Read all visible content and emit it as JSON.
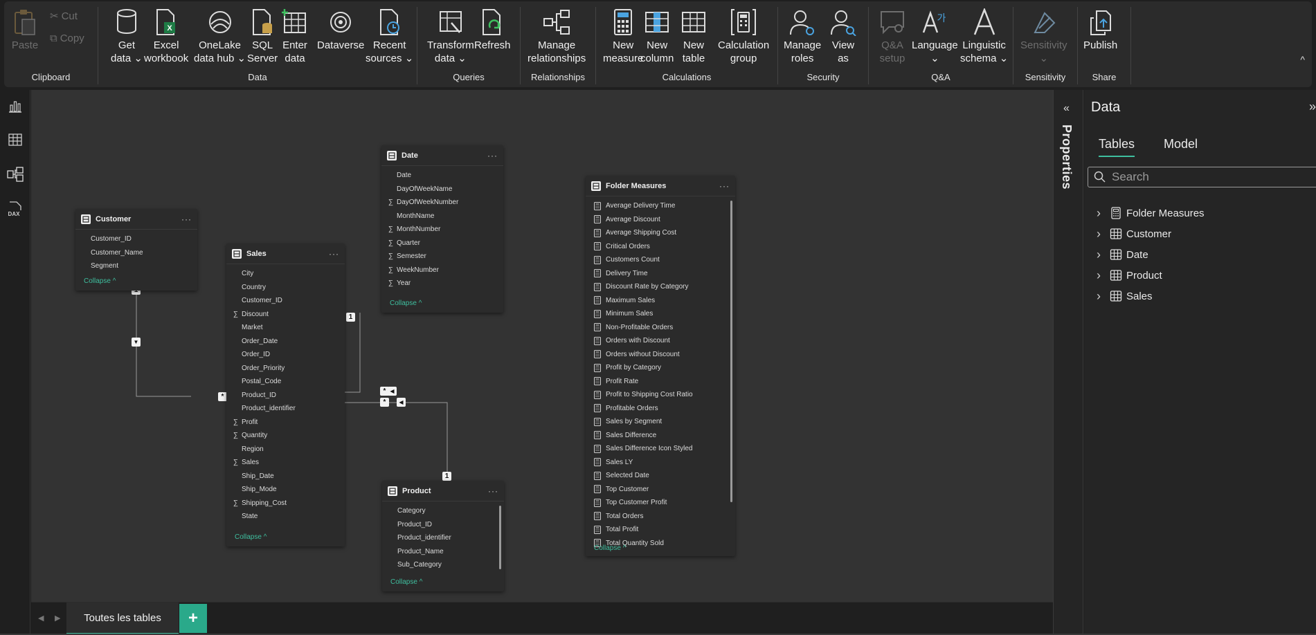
{
  "ribbon": {
    "clipboard": {
      "group_label": "Clipboard",
      "paste": "Paste",
      "cut": "Cut",
      "copy": "Copy"
    },
    "data": {
      "group_label": "Data",
      "get_data": "Get\ndata ⌄",
      "excel": "Excel\nworkbook",
      "onelake": "OneLake\ndata hub ⌄",
      "sql": "SQL\nServer",
      "enter": "Enter\ndata",
      "dataverse": "Dataverse",
      "recent": "Recent\nsources ⌄"
    },
    "queries": {
      "group_label": "Queries",
      "transform": "Transform\ndata ⌄",
      "refresh": "Refresh"
    },
    "relationships": {
      "group_label": "Relationships",
      "manage": "Manage\nrelationships"
    },
    "calculations": {
      "group_label": "Calculations",
      "new_measure": "New\nmeasure",
      "new_column": "New\ncolumn",
      "new_table": "New\ntable",
      "calc_group": "Calculation\ngroup"
    },
    "security": {
      "group_label": "Security",
      "manage_roles": "Manage\nroles",
      "view_as": "View\nas"
    },
    "qa": {
      "group_label": "Q&A",
      "qa_setup": "Q&A\nsetup",
      "language": "Language\n⌄",
      "linguistic": "Linguistic\nschema ⌄"
    },
    "sensitivity": {
      "group_label": "Sensitivity",
      "sensitivity": "Sensitivity\n⌄"
    },
    "share": {
      "group_label": "Share",
      "publish": "Publish"
    }
  },
  "rail": {
    "dax_label": "DAX"
  },
  "tables": {
    "customer": {
      "name": "Customer",
      "fields": [
        {
          "sig": "",
          "name": "Customer_ID"
        },
        {
          "sig": "",
          "name": "Customer_Name"
        },
        {
          "sig": "",
          "name": "Segment"
        }
      ],
      "collapse": "Collapse ^"
    },
    "sales": {
      "name": "Sales",
      "fields": [
        {
          "sig": "",
          "name": "City"
        },
        {
          "sig": "",
          "name": "Country"
        },
        {
          "sig": "",
          "name": "Customer_ID"
        },
        {
          "sig": "∑",
          "name": "Discount"
        },
        {
          "sig": "",
          "name": "Market"
        },
        {
          "sig": "",
          "name": "Order_Date"
        },
        {
          "sig": "",
          "name": "Order_ID"
        },
        {
          "sig": "",
          "name": "Order_Priority"
        },
        {
          "sig": "",
          "name": "Postal_Code"
        },
        {
          "sig": "",
          "name": "Product_ID"
        },
        {
          "sig": "",
          "name": "Product_identifier"
        },
        {
          "sig": "∑",
          "name": "Profit"
        },
        {
          "sig": "∑",
          "name": "Quantity"
        },
        {
          "sig": "",
          "name": "Region"
        },
        {
          "sig": "∑",
          "name": "Sales"
        },
        {
          "sig": "",
          "name": "Ship_Date"
        },
        {
          "sig": "",
          "name": "Ship_Mode"
        },
        {
          "sig": "∑",
          "name": "Shipping_Cost"
        },
        {
          "sig": "",
          "name": "State"
        }
      ],
      "collapse": "Collapse ^"
    },
    "date": {
      "name": "Date",
      "fields": [
        {
          "sig": "",
          "name": "Date"
        },
        {
          "sig": "",
          "name": "DayOfWeekName"
        },
        {
          "sig": "∑",
          "name": "DayOfWeekNumber"
        },
        {
          "sig": "",
          "name": "MonthName"
        },
        {
          "sig": "∑",
          "name": "MonthNumber"
        },
        {
          "sig": "∑",
          "name": "Quarter"
        },
        {
          "sig": "∑",
          "name": "Semester"
        },
        {
          "sig": "∑",
          "name": "WeekNumber"
        },
        {
          "sig": "∑",
          "name": "Year"
        }
      ],
      "collapse": "Collapse ^"
    },
    "product": {
      "name": "Product",
      "fields": [
        {
          "sig": "",
          "name": "Category"
        },
        {
          "sig": "",
          "name": "Product_ID"
        },
        {
          "sig": "",
          "name": "Product_identifier"
        },
        {
          "sig": "",
          "name": "Product_Name"
        },
        {
          "sig": "",
          "name": "Sub_Category"
        }
      ],
      "collapse": "Collapse ^"
    },
    "folder_measures": {
      "name": "Folder Measures",
      "fields": [
        "Average Delivery Time",
        "Average Discount",
        "Average Shipping Cost",
        "Critical Orders",
        "Customers Count",
        "Delivery Time",
        "Discount Rate by Category",
        "Maximum Sales",
        "Minimum Sales",
        "Non-Profitable Orders",
        "Orders with Discount",
        "Orders without Discount",
        "Profit by Category",
        "Profit Rate",
        "Profit to Shipping Cost Ratio",
        "Profitable Orders",
        "Sales by Segment",
        "Sales Difference",
        "Sales Difference Icon Styled",
        "Sales LY",
        "Selected Date",
        "Top Customer",
        "Top Customer Profit",
        "Total Orders",
        "Total Profit",
        "Total Quantity Sold"
      ],
      "collapse": "Collapse ^"
    }
  },
  "relationships": {
    "one": "1",
    "many": "*"
  },
  "tabbar": {
    "tab_label": "Toutes les tables",
    "add": "+"
  },
  "properties": {
    "title": "Properties",
    "expand": "«"
  },
  "data_pane": {
    "title": "Data",
    "close": "»",
    "tabs": [
      "Tables",
      "Model"
    ],
    "search_placeholder": "Search",
    "items": [
      "Folder Measures",
      "Customer",
      "Date",
      "Product",
      "Sales"
    ]
  },
  "colors": {
    "accent": "#3fbf9f",
    "background": "#333333",
    "card": "#2b2b2b"
  }
}
